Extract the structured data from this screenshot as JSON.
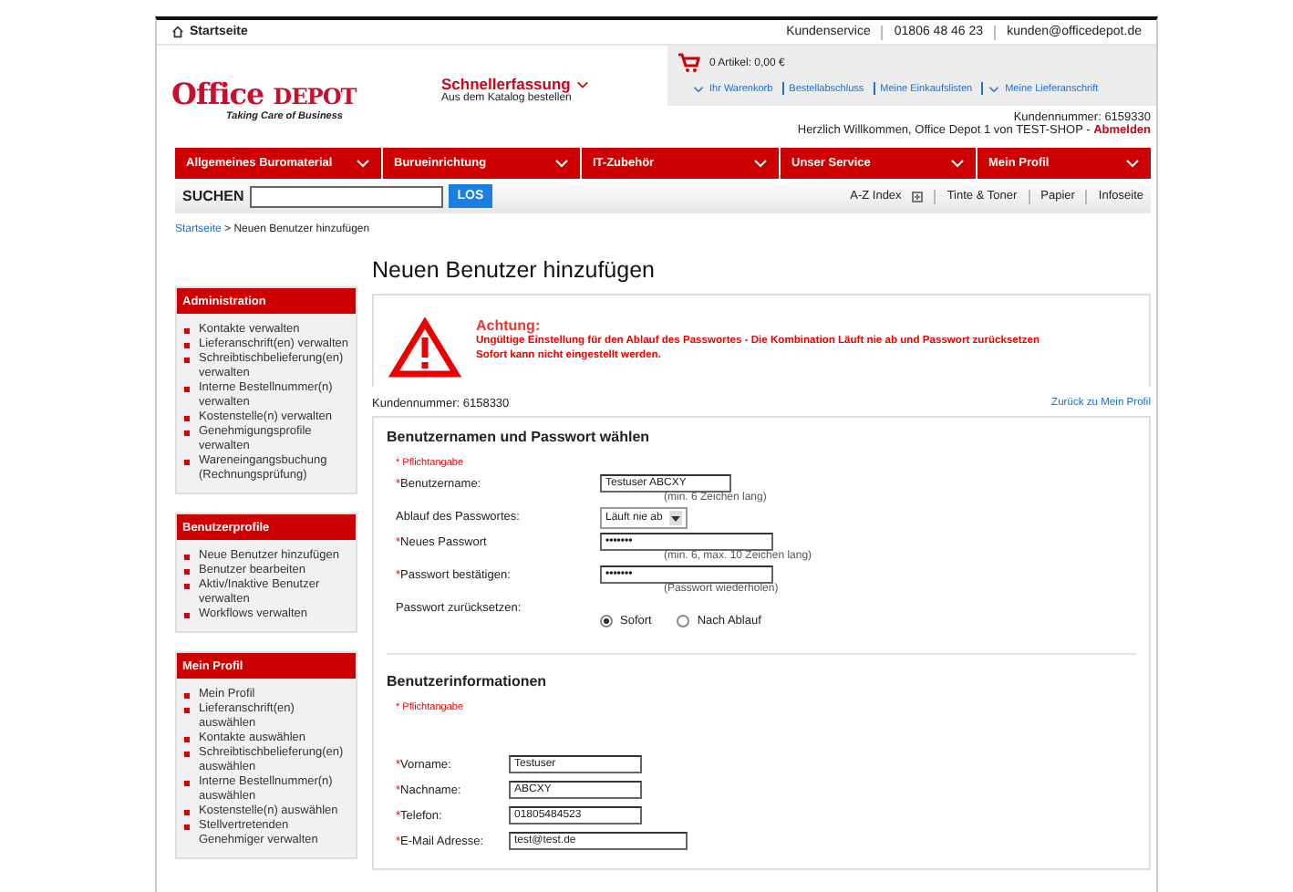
{
  "top_bar": {
    "home": "Startseite",
    "links": [
      "Kundenservice",
      "01806 48 46 23",
      "kunden@officedepot.de"
    ]
  },
  "logo": {
    "name": "Office",
    "name_bold": "DEPOT",
    "tagline": "Taking Care of Business"
  },
  "quick_entry": {
    "title": "Schnellerfassung",
    "subtitle": "Aus dem Katalog bestellen"
  },
  "cart": {
    "summary": "0 Artikel: 0,00 €",
    "links": [
      {
        "label": "Ihr Warenkorb",
        "chevron": true
      },
      {
        "label": "Bestellabschluss",
        "chevron": false
      },
      {
        "label": "Meine Einkaufslisten",
        "chevron": false
      },
      {
        "label": "Meine Lieferanschrift",
        "chevron": true
      }
    ]
  },
  "customer_number": "Kundennummer: 6159330",
  "welcome": "Herzlich Willkommen, Office Depot 1 von TEST-SHOP -",
  "logout": "Abmelden",
  "nav": [
    "Allgemeines Buromaterial",
    "Burueinrichtung",
    "IT-Zubehör",
    "Unser Service",
    "Mein Profil"
  ],
  "search": {
    "label": "SUCHEN",
    "button": "LOS",
    "links": [
      "A-Z Index",
      "Tinte & Toner",
      "Papier",
      "Infoseite"
    ]
  },
  "breadcrumb": {
    "home": "Startseite",
    "sep": ">",
    "current": "Neuen Benutzer hinzufügen"
  },
  "sidebar": [
    {
      "title": "Administration",
      "items": [
        "Kontakte verwalten",
        "Lieferanschrift(en) verwalten",
        "Schreibtischbelieferung(en) verwalten",
        "Interne Bestellnummer(n) verwalten",
        "Kostenstelle(n) verwalten",
        "Genehmigungsprofile verwalten",
        "Wareneingangsbuchung (Rechnungsprüfung)"
      ]
    },
    {
      "title": "Benutzerprofile",
      "items": [
        "Neue Benutzer hinzufügen",
        "Benutzer bearbeiten",
        "Aktiv/Inaktive Benutzer verwalten",
        "Workflows verwalten"
      ]
    },
    {
      "title": "Mein Profil",
      "items": [
        "Mein Profil",
        "Lieferanschrift(en) auswählen",
        "Kontakte auswählen",
        "Schreibtischbelieferung(en) auswählen",
        "Interne Bestellnummer(n) auswählen",
        "Kostenstelle(n) auswählen",
        "Stellvertretenden Genehmiger verwalten"
      ]
    }
  ],
  "page_title": "Neuen Benutzer hinzufügen",
  "alert": {
    "title": "Achtung:",
    "message": "Ungültige Einstellung für den Ablauf des Passwortes - Die Kombination Läuft nie ab und Passwort zurücksetzen Sofort kann nicht eingestellt werden."
  },
  "customer_line": "Kundennummer: 6158330",
  "back_link": "Zurück zu Mein Profil",
  "section_login": {
    "title": "Benutzernamen und Passwort wählen",
    "required_note": "* Pflichtangabe",
    "rows": [
      {
        "kind": "text",
        "label": "Benutzername:",
        "mark": "*",
        "value": "Testuser ABCXY",
        "hint": "(min. 6 Zeichen lang)"
      },
      {
        "kind": "select",
        "label": "Ablauf des Passwortes:",
        "value": "Läuft nie ab"
      },
      {
        "kind": "text",
        "label": "Neues Passwort",
        "mark": "*",
        "value": "•••••••",
        "hint": "(min. 6, max. 10 Zeichen lang)"
      },
      {
        "kind": "text",
        "label": "Passwort bestätigen:",
        "mark": "*",
        "value": "•••••••",
        "hint": "(Passwort wiederholen)"
      },
      {
        "kind": "radio",
        "label": "Passwort zurücksetzen:",
        "options": [
          {
            "label": "Sofort",
            "selected": true
          },
          {
            "label": "Nach Ablauf",
            "selected": false
          }
        ]
      }
    ]
  },
  "section_info": {
    "title": "Benutzerinformationen",
    "required_note": "* Pflichtangabe",
    "rows": [
      {
        "label": "Vorname:",
        "mark": "*",
        "value": "Testuser"
      },
      {
        "label": "Nachname:",
        "mark": "*",
        "value": "ABCXY"
      },
      {
        "label": "Telefon:",
        "mark": "*",
        "value": "01805484523"
      },
      {
        "label": "E-Mail Adresse:",
        "mark": "*",
        "value": "test@test.de"
      }
    ]
  }
}
